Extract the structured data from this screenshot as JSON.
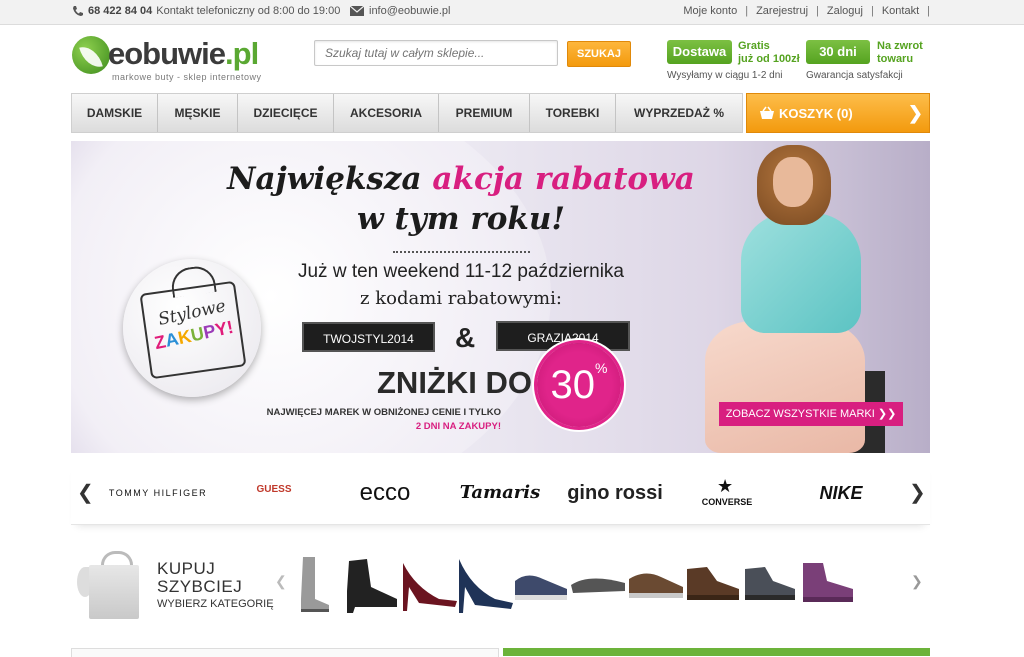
{
  "topbar": {
    "phone": "68 422 84 04",
    "phone_note": "Kontakt telefoniczny od 8:00 do 19:00",
    "email": "info@eobuwie.pl",
    "links": [
      "Moje konto",
      "Zarejestruj",
      "Zaloguj",
      "Kontakt"
    ]
  },
  "logo": {
    "name": "eobuwie",
    "tld": ".pl",
    "tagline": "markowe buty - sklep internetowy"
  },
  "search": {
    "placeholder": "Szukaj tutaj w całym sklepie...",
    "button": "SZUKAJ"
  },
  "promos": {
    "delivery_badge": "Dostawa",
    "delivery_text_1": "Gratis",
    "delivery_text_2": "już od 100zł",
    "delivery_sub": "Wysyłamy w ciągu 1-2 dni",
    "return_badge": "30 dni",
    "return_text_1": "Na zwrot",
    "return_text_2": "towaru",
    "return_sub": "Gwarancja satysfakcji"
  },
  "nav": {
    "items": [
      "DAMSKIE",
      "MĘSKIE",
      "DZIECIĘCE",
      "AKCESORIA",
      "PREMIUM",
      "TOREBKI",
      "WYPRZEDAŻ %"
    ]
  },
  "cart": {
    "label": "KOSZYK (0)",
    "arrow": "❯"
  },
  "banner": {
    "headline_a": "Największa ",
    "headline_b": "akcja rabatowa",
    "headline_c": "w tym roku!",
    "line3": "Już w ten weekend  11-12 października",
    "line4": "z kodami rabatowymi:",
    "code1": "TWOJSTYL2014",
    "amp": "&",
    "code2": "GRAZIA2014",
    "discount": "ZNIŻKI DO",
    "percent": "30",
    "percent_sign": "%",
    "small1": "NAJWIĘCEJ MAREK W OBNIŻONEJ CENIE I TYLKO",
    "small2": "2 DNI NA ZAKUPY!",
    "badge_1": "Stylowe",
    "badge_2": [
      "Z",
      "A",
      "K",
      "U",
      "P",
      "Y!"
    ],
    "cta": "ZOBACZ WSZYSTKIE MARKI ❯❯"
  },
  "brands": {
    "prev": "❮",
    "next": "❯",
    "list": [
      "TOMMY HILFIGER",
      "GUESS",
      "ecco",
      "Tamaris",
      "gino rossi",
      "CONVERSE",
      "NIKE"
    ]
  },
  "kupuj": {
    "line1": "KUPUJ",
    "line2": "SZYBCIEJ",
    "line3": "WYBIERZ KATEGORIĘ",
    "prev": "❮",
    "next": "❯"
  }
}
